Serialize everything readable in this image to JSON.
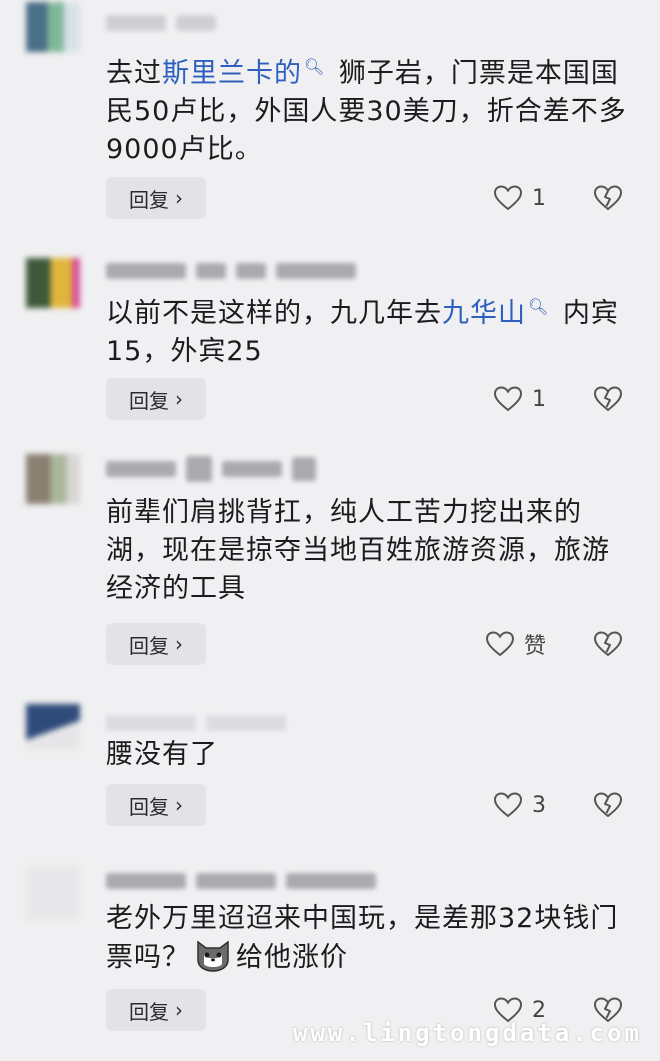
{
  "comments": [
    {
      "text_before": "去过",
      "link": "斯里兰卡的",
      "text_after": " 狮子岩，门票是本国国民50卢比，外国人要30美刀，折合差不多9000卢比。",
      "reply_label": "回复",
      "like_count": "1"
    },
    {
      "text_before": "以前不是这样的，九几年去",
      "link": "九华山",
      "text_after": " 内宾15，外宾25",
      "reply_label": "回复",
      "like_count": "1"
    },
    {
      "text": "前辈们肩挑背扛，纯人工苦力挖出来的湖，现在是掠夺当地百姓旅游资源，旅游经济的工具",
      "reply_label": "回复",
      "like_count": "赞"
    },
    {
      "text": "腰没有了",
      "reply_label": "回复",
      "like_count": "3"
    },
    {
      "text_line1": "老外万里迢迢来中国玩，是差那32块钱门",
      "text_line2_before": "票吗？",
      "text_line2_after": "给他涨价",
      "reply_label": "回复",
      "like_count": "2"
    }
  ],
  "icons": {
    "like": "heart-outline-icon",
    "dislike": "broken-heart-icon",
    "search_mark": "search-icon",
    "emoji": "cat-emoji-icon"
  },
  "colors": {
    "background": "#f0f0f2",
    "link": "#2d5fbf",
    "reply_button": "#e3e3e6"
  },
  "watermark": "www.lingtongdata.com"
}
